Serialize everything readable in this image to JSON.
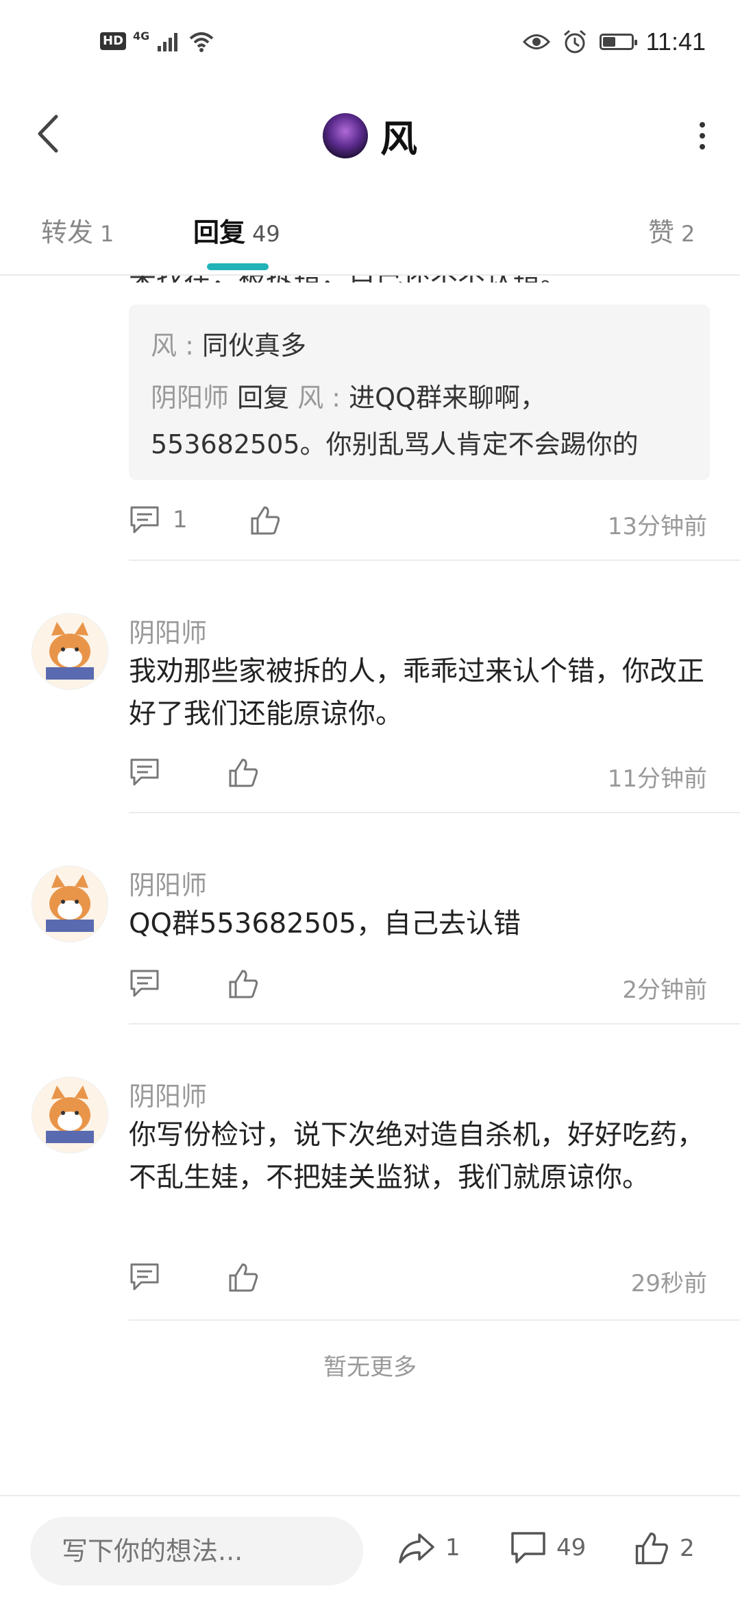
{
  "status_bar": {
    "hd": "HD",
    "network": "4G",
    "time": "11:41",
    "battery_level": 0.45
  },
  "header": {
    "title": "风",
    "back_icon": "chevron-left-icon",
    "more_icon": "more-vertical-icon"
  },
  "tabs": [
    {
      "label": "转发",
      "count": "1"
    },
    {
      "label": "回复",
      "count": "49",
      "active": true
    },
    {
      "label": "赞",
      "count": "2"
    }
  ],
  "clipped_text": "来找茬，被拆错，自己还不不认错。",
  "quote": {
    "line1_user": "风",
    "line1_sep": " : ",
    "line1_text": "同伙真多",
    "line2_user": "阴阳师",
    "line2_action": " 回复 ",
    "line2_target": "风",
    "line2_sep": " : ",
    "line2_text": "进QQ群来聊啊，",
    "line3_text": "553682505。你别乱骂人肯定不会踢你的"
  },
  "first_actions": {
    "reply_count": "1",
    "time": "13分钟前"
  },
  "comments": [
    {
      "name": "阴阳师",
      "text": "我劝那些家被拆的人，乖乖过来认个错，你改正好了我们还能原谅你。",
      "time": "11分钟前"
    },
    {
      "name": "阴阳师",
      "text": "QQ群553682505，自己去认错",
      "time": "2分钟前"
    },
    {
      "name": "阴阳师",
      "text": "你写份检讨，说下次绝对造自杀机，好好吃药，不乱生娃，不把娃关监狱，我们就原谅你。",
      "time": "29秒前"
    }
  ],
  "no_more": "暂无更多",
  "bottom_bar": {
    "input_placeholder": "写下你的想法...",
    "share_count": "1",
    "comment_count": "49",
    "like_count": "2"
  },
  "colors": {
    "accent": "#21b3b8",
    "muted": "#999999",
    "quote_bg": "#f5f5f5"
  }
}
